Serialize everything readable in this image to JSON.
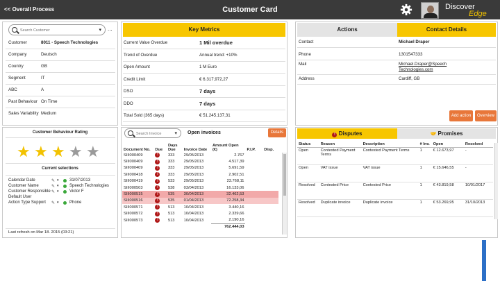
{
  "header": {
    "back_label": "<< Overall Process",
    "title": "Customer Card",
    "logo_main": "Discover",
    "logo_sub": "Edge"
  },
  "customer": {
    "search_placeholder": "Search Customer",
    "more": "...",
    "fields": [
      {
        "label": "Customer",
        "value": "8011 - Speech Technologies"
      },
      {
        "label": "Company",
        "value": "Deutsch"
      },
      {
        "label": "Country",
        "value": "GB"
      },
      {
        "label": "Segment",
        "value": "IT"
      },
      {
        "label": "ABC",
        "value": "A"
      },
      {
        "label": "Past Behaviour",
        "value": "On Time"
      },
      {
        "label": "Sales Variability",
        "value": "Medium"
      }
    ]
  },
  "metrics": {
    "title": "Key Metrics",
    "rows": [
      {
        "label": "Current Value Overdue",
        "value": "1 Mil overdue"
      },
      {
        "label": "Trend of Overdue",
        "value": "Annual trend: +10%"
      },
      {
        "label": "Open Amount",
        "value": "1 M Euro"
      },
      {
        "label": "Credit Limit",
        "value": "€ 6.317,972,27"
      },
      {
        "label": "DSO",
        "value": "7 days"
      },
      {
        "label": "DDO",
        "value": "7 days"
      },
      {
        "label": "Total Sold (365 days)",
        "value": "€ 51.245.137,31"
      }
    ]
  },
  "actions": {
    "tab_actions": "Actions",
    "tab_contact": "Contact Details",
    "contact_rows": [
      {
        "label": "Contact",
        "value": "Michael Draper"
      },
      {
        "label": "Phone",
        "value": "1301547333"
      },
      {
        "label": "Mail",
        "value": "Michael.Draper@Speech Technologies.com"
      },
      {
        "label": "Address",
        "value": "Cardiff, GB"
      }
    ],
    "add_action": "Add action",
    "overview": "Overview"
  },
  "behaviour": {
    "title": "Customer Behaviour Rating",
    "rating": 3,
    "max_rating": 5,
    "star_filled_color": "#f2c200",
    "star_empty_color": "#9a9a9a"
  },
  "selections": {
    "title": "Current selections",
    "rows": [
      {
        "label": "Calendar Date",
        "value": "31/07/2013"
      },
      {
        "label": "Customer Name",
        "value": "Speech Technologies"
      },
      {
        "label": "Customer Responsible",
        "value": "Victor F"
      },
      {
        "label": "Default User",
        "value": ""
      },
      {
        "label": "Action Type Support",
        "value": "Phone"
      }
    ],
    "last_refresh": "Last refresh on Mar 18. 2015 (03:21)"
  },
  "invoices": {
    "search_placeholder": "Search Invoice",
    "title": "Open invoices",
    "details_button": "Details",
    "columns": [
      "Document No.",
      "Due",
      "Days Due",
      "Invoice Date",
      "Amount Open (€)",
      "P.I.P.",
      "Disp."
    ],
    "rows": [
      {
        "doc": "SIII000409",
        "days": "333",
        "date": "29/05/2013",
        "amount": "2.767"
      },
      {
        "doc": "SIII000409",
        "days": "333",
        "date": "29/05/2013",
        "amount": "4.517,39"
      },
      {
        "doc": "SIII000409",
        "days": "333",
        "date": "29/05/2013",
        "amount": "5.691,59"
      },
      {
        "doc": "SIII000418",
        "days": "333",
        "date": "29/05/2013",
        "amount": "2.902,51"
      },
      {
        "doc": "SIII000419",
        "days": "533",
        "date": "29/05/2013",
        "amount": "23.768,11"
      },
      {
        "doc": "SIII000503",
        "days": "538",
        "date": "03/04/2013",
        "amount": "16.133,06"
      },
      {
        "doc": "SIII000515",
        "days": "535",
        "date": "30/04/2013",
        "amount": "32.462,53",
        "highlight": "strong"
      },
      {
        "doc": "SIII000516",
        "days": "535",
        "date": "01/04/2013",
        "amount": "72.258,34",
        "highlight": "light"
      },
      {
        "doc": "SIII000571",
        "days": "513",
        "date": "10/04/2013",
        "amount": "3.440,16"
      },
      {
        "doc": "SIII000572",
        "days": "513",
        "date": "10/04/2013",
        "amount": "2.339,66"
      },
      {
        "doc": "SIII000573",
        "days": "513",
        "date": "10/04/2013",
        "amount": "2.190,16"
      }
    ],
    "total": "762.444,03"
  },
  "disputes": {
    "tab_disputes": "Disputes",
    "tab_promises": "Promises",
    "columns": [
      "Status",
      "Reason",
      "Description",
      "# Inv.",
      "Open",
      "Resolved"
    ],
    "rows": [
      {
        "status": "Open",
        "reason": "Contested Payment Terms",
        "description": "Contested Payment Terms",
        "inv": "1",
        "open": "€ 12.673,97",
        "resolved": "-"
      },
      {
        "status": "Open",
        "reason": "VAT issue",
        "description": "VAT issue",
        "inv": "1",
        "open": "€ 15.646,55",
        "resolved": "-"
      },
      {
        "status": "Resolved",
        "reason": "Contested Price",
        "description": "Contested Price",
        "inv": "1",
        "open": "€ 43.819,58",
        "resolved": "10/01/2017"
      },
      {
        "status": "Resolved",
        "reason": "Duplicate invoice",
        "description": "Duplicate invoice",
        "inv": "1",
        "open": "€ 53.269,95",
        "resolved": "31/10/2013"
      }
    ]
  }
}
